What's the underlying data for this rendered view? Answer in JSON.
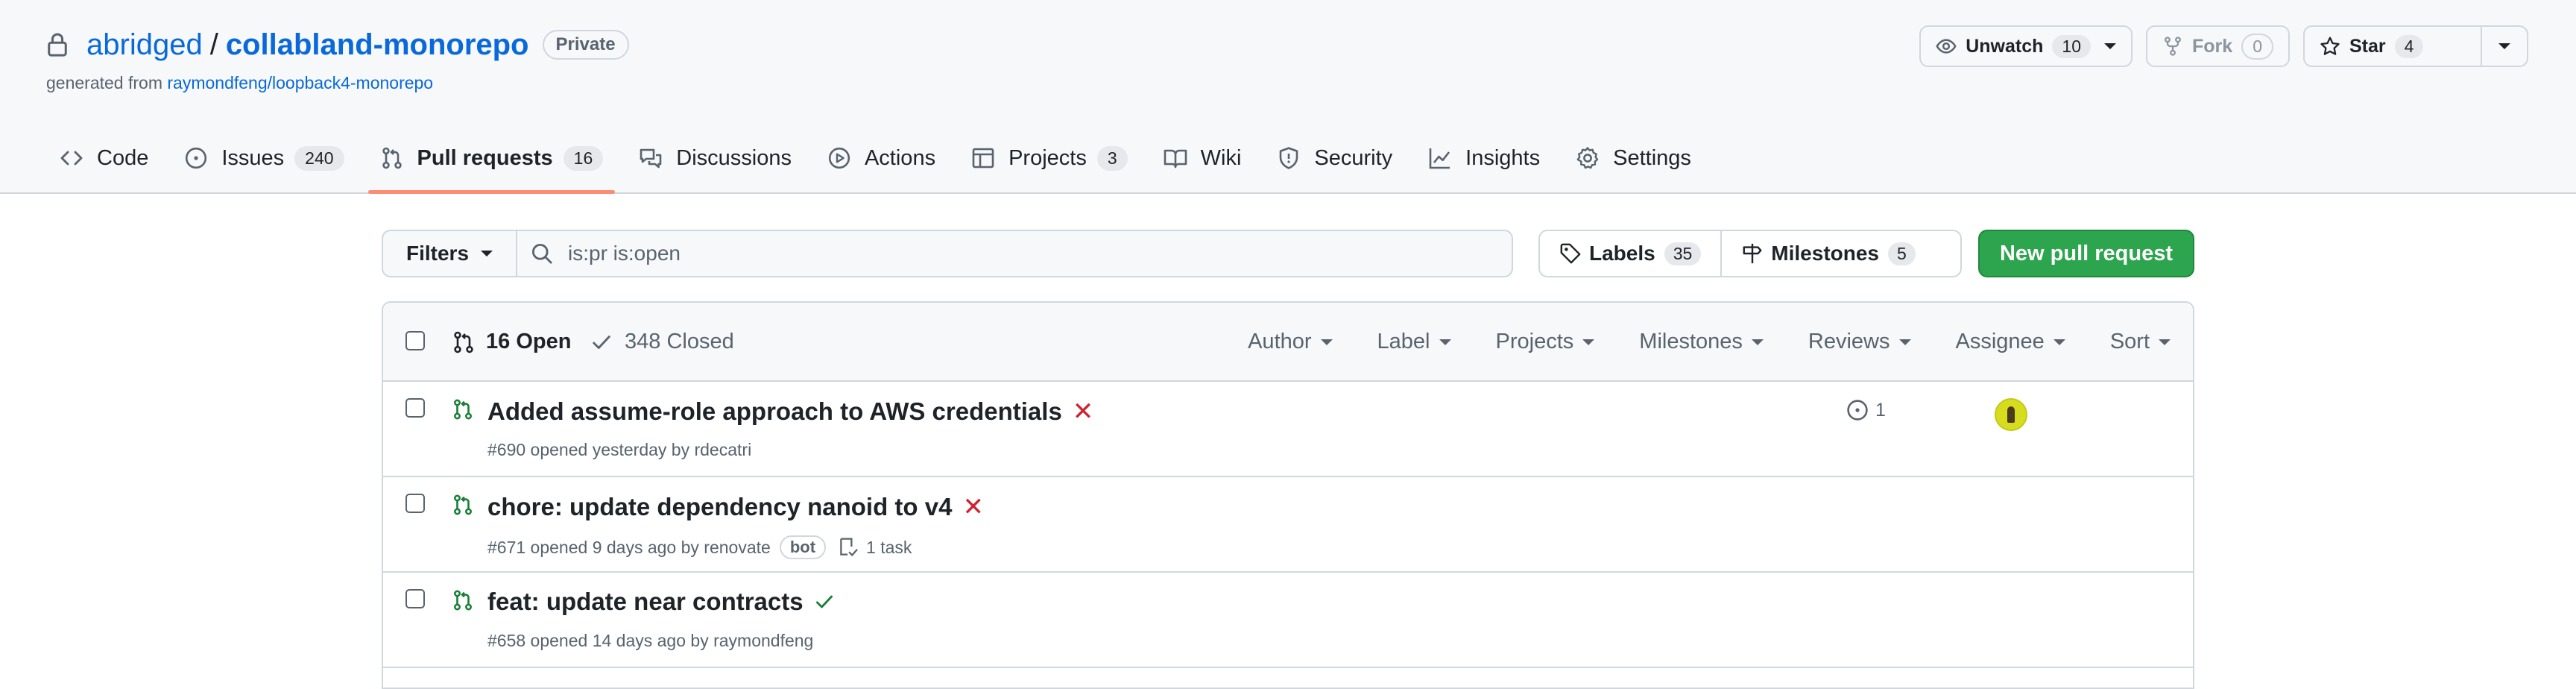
{
  "repo": {
    "owner": "abridged",
    "separator": "/",
    "name": "collabland-monorepo",
    "visibility": "Private",
    "generated_prefix": "generated from",
    "template": "raymondfeng/loopback4-monorepo"
  },
  "actions": {
    "watch_label": "Unwatch",
    "watch_count": "10",
    "fork_label": "Fork",
    "fork_count": "0",
    "star_label": "Star",
    "star_count": "4"
  },
  "tabs": [
    {
      "label": "Code",
      "icon": "code-icon"
    },
    {
      "label": "Issues",
      "icon": "issue-icon",
      "count": "240"
    },
    {
      "label": "Pull requests",
      "icon": "pull-request-icon",
      "count": "16"
    },
    {
      "label": "Discussions",
      "icon": "discussions-icon"
    },
    {
      "label": "Actions",
      "icon": "play-icon"
    },
    {
      "label": "Projects",
      "icon": "table-icon",
      "count": "3"
    },
    {
      "label": "Wiki",
      "icon": "book-icon"
    },
    {
      "label": "Security",
      "icon": "shield-icon"
    },
    {
      "label": "Insights",
      "icon": "graph-icon"
    },
    {
      "label": "Settings",
      "icon": "gear-icon"
    }
  ],
  "filterbar": {
    "filters_label": "Filters",
    "search_value": "is:pr is:open",
    "labels_label": "Labels",
    "labels_count": "35",
    "milestones_label": "Milestones",
    "milestones_count": "5",
    "new_pr_label": "New pull request"
  },
  "list_header": {
    "open_label": "16 Open",
    "closed_label": "348 Closed",
    "filters": [
      "Author",
      "Label",
      "Projects",
      "Milestones",
      "Reviews",
      "Assignee",
      "Sort"
    ]
  },
  "pull_requests": [
    {
      "title": "Added assume-role approach to AWS credentials",
      "status": "failure",
      "status_symbol": "✕",
      "meta": "#690 opened yesterday by rdecatri",
      "review_count": "1"
    },
    {
      "title": "chore: update dependency nanoid to v4",
      "status": "failure",
      "status_symbol": "✕",
      "meta": "#671 opened 9 days ago by renovate",
      "badge": "bot",
      "task": "1 task"
    },
    {
      "title": "feat: update near contracts",
      "status": "success",
      "meta": "#658 opened 14 days ago by raymondfeng"
    }
  ],
  "colors": {
    "link": "#0969da",
    "success_button": "#2da44e",
    "failure": "#cf222e",
    "open_pr": "#1a7f37",
    "tab_underline": "#fd8c73"
  }
}
